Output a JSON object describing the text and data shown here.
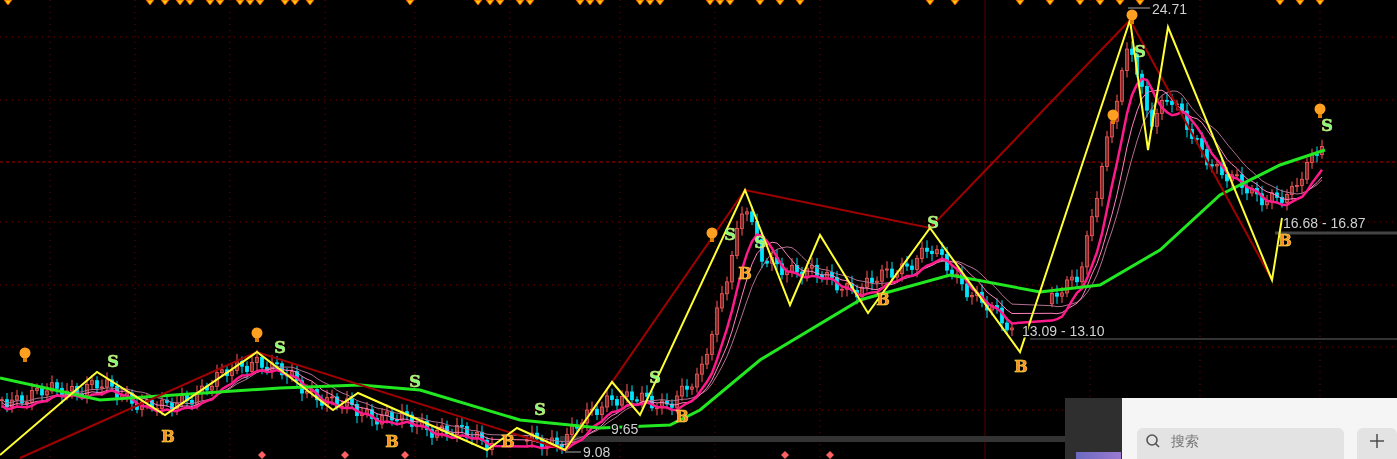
{
  "chart": {
    "price_labels": [
      {
        "text": "24.71"
      },
      {
        "text": "16.68 - 16.87"
      },
      {
        "text": "13.09 - 13.10"
      },
      {
        "text": "9.65"
      },
      {
        "text": "9.08"
      }
    ],
    "signals": [
      {
        "kind": "sell",
        "label": "S"
      },
      {
        "kind": "sell",
        "label": "S"
      },
      {
        "kind": "sell",
        "label": "S"
      },
      {
        "kind": "sell",
        "label": "S"
      },
      {
        "kind": "sell",
        "label": "S"
      },
      {
        "kind": "sell",
        "label": "S"
      },
      {
        "kind": "sell",
        "label": "S"
      },
      {
        "kind": "sell",
        "label": "S"
      },
      {
        "kind": "sell",
        "label": "S"
      },
      {
        "kind": "sell",
        "label": "S"
      },
      {
        "kind": "buy",
        "label": "B"
      },
      {
        "kind": "buy",
        "label": "B"
      },
      {
        "kind": "buy",
        "label": "B"
      },
      {
        "kind": "buy",
        "label": "B"
      },
      {
        "kind": "buy",
        "label": "B"
      },
      {
        "kind": "buy",
        "label": "B"
      },
      {
        "kind": "buy",
        "label": "B"
      },
      {
        "kind": "buy",
        "label": "B"
      }
    ]
  },
  "overlay": {
    "search": {
      "placeholder": "搜索"
    }
  }
}
